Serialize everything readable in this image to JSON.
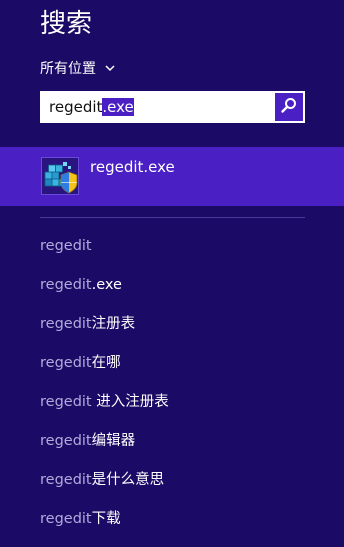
{
  "header": {
    "title": "搜索"
  },
  "scope": {
    "label": "所有位置"
  },
  "search": {
    "typed": "regedit",
    "autocomplete": ".exe"
  },
  "result": {
    "name_query": "regedit",
    "name_rest": ".exe",
    "icon": "registry-editor-icon"
  },
  "suggestions": [
    {
      "query": "regedit",
      "rest": ""
    },
    {
      "query": "regedit",
      "rest": ".exe"
    },
    {
      "query": "regedit",
      "rest": "注册表"
    },
    {
      "query": "regedit",
      "rest": "在哪"
    },
    {
      "query": "regedit",
      "rest": " 进入注册表"
    },
    {
      "query": "regedit",
      "rest": "编辑器"
    },
    {
      "query": "regedit",
      "rest": "是什么意思"
    },
    {
      "query": "regedit",
      "rest": "下载"
    }
  ],
  "colors": {
    "background": "#1b0a66",
    "accent": "#4a1fc4",
    "muted_text": "#b3aadb"
  }
}
